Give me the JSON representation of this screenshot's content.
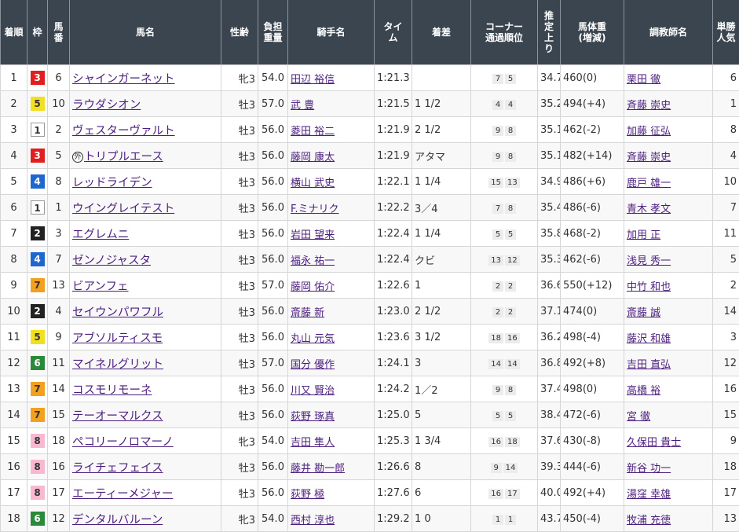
{
  "headers": [
    "着順",
    "枠",
    "馬番",
    "馬名",
    "性齢",
    "負担重量",
    "騎手名",
    "タイム",
    "着差",
    "コーナー通過順位",
    "推定上り",
    "馬体重(増減)",
    "調教師名",
    "単勝人気"
  ],
  "header_html": [
    "着順",
    "枠",
    "馬<br>番",
    "馬名",
    "性齢",
    "負担<br>重量",
    "騎手名",
    "タイ<br>ム",
    "着差",
    "コーナー<br>通過順位",
    "推<br>定<br>上<br>り",
    "馬体重<br>(増減)",
    "調教師名",
    "単勝<br>人気"
  ],
  "rows": [
    {
      "rank": "1",
      "waku": "3",
      "num": "6",
      "mark": "",
      "horse": "シャインガーネット",
      "sex_age": "牝3",
      "weight": "54.0",
      "jockey": "田辺 裕信",
      "time": "1:21.3",
      "margin": "",
      "corners": [
        "7",
        "5"
      ],
      "last3f": "34.7",
      "body_weight": "460(0)",
      "trainer": "栗田 徹",
      "pop": "6"
    },
    {
      "rank": "2",
      "waku": "5",
      "num": "10",
      "mark": "",
      "horse": "ラウダシオン",
      "sex_age": "牡3",
      "weight": "57.0",
      "jockey": "武 豊",
      "time": "1:21.5",
      "margin": "1 1/2",
      "corners": [
        "4",
        "4"
      ],
      "last3f": "35.2",
      "body_weight": "494(+4)",
      "trainer": "斉藤 崇史",
      "pop": "1"
    },
    {
      "rank": "3",
      "waku": "1",
      "num": "2",
      "mark": "",
      "horse": "ヴェスターヴァルト",
      "sex_age": "牡3",
      "weight": "56.0",
      "jockey": "菱田 裕二",
      "time": "1:21.9",
      "margin": "2 1/2",
      "corners": [
        "9",
        "8"
      ],
      "last3f": "35.1",
      "body_weight": "462(-2)",
      "trainer": "加藤 征弘",
      "pop": "8"
    },
    {
      "rank": "4",
      "waku": "3",
      "num": "5",
      "mark": "外",
      "horse": "トリプルエース",
      "sex_age": "牡3",
      "weight": "56.0",
      "jockey": "藤岡 康太",
      "time": "1:21.9",
      "margin": "アタマ",
      "corners": [
        "9",
        "8"
      ],
      "last3f": "35.1",
      "body_weight": "482(+14)",
      "trainer": "斉藤 崇史",
      "pop": "4"
    },
    {
      "rank": "5",
      "waku": "4",
      "num": "8",
      "mark": "",
      "horse": "レッドライデン",
      "sex_age": "牡3",
      "weight": "56.0",
      "jockey": "横山 武史",
      "time": "1:22.1",
      "margin": "1 1/4",
      "corners": [
        "15",
        "13"
      ],
      "last3f": "34.9",
      "body_weight": "486(+6)",
      "trainer": "鹿戸 雄一",
      "pop": "10"
    },
    {
      "rank": "6",
      "waku": "1",
      "num": "1",
      "mark": "",
      "horse": "ウイングレイテスト",
      "sex_age": "牡3",
      "weight": "56.0",
      "jockey": "F.ミナリク",
      "time": "1:22.2",
      "margin": "3／4",
      "corners": [
        "7",
        "8"
      ],
      "last3f": "35.4",
      "body_weight": "486(-6)",
      "trainer": "青木 孝文",
      "pop": "7"
    },
    {
      "rank": "7",
      "waku": "2",
      "num": "3",
      "mark": "",
      "horse": "エグレムニ",
      "sex_age": "牡3",
      "weight": "56.0",
      "jockey": "岩田 望来",
      "time": "1:22.4",
      "margin": "1 1/4",
      "corners": [
        "5",
        "5"
      ],
      "last3f": "35.8",
      "body_weight": "468(-2)",
      "trainer": "加用 正",
      "pop": "11"
    },
    {
      "rank": "8",
      "waku": "4",
      "num": "7",
      "mark": "",
      "horse": "ゼンノジャスタ",
      "sex_age": "牡3",
      "weight": "56.0",
      "jockey": "福永 祐一",
      "time": "1:22.4",
      "margin": "クビ",
      "corners": [
        "13",
        "12"
      ],
      "last3f": "35.3",
      "body_weight": "462(-6)",
      "trainer": "浅見 秀一",
      "pop": "5"
    },
    {
      "rank": "9",
      "waku": "7",
      "num": "13",
      "mark": "",
      "horse": "ビアンフェ",
      "sex_age": "牡3",
      "weight": "57.0",
      "jockey": "藤岡 佑介",
      "time": "1:22.6",
      "margin": "1",
      "corners": [
        "2",
        "2"
      ],
      "last3f": "36.6",
      "body_weight": "550(+12)",
      "trainer": "中竹 和也",
      "pop": "2"
    },
    {
      "rank": "10",
      "waku": "2",
      "num": "4",
      "mark": "",
      "horse": "セイウンパワフル",
      "sex_age": "牡3",
      "weight": "56.0",
      "jockey": "斎藤 新",
      "time": "1:23.0",
      "margin": "2 1/2",
      "corners": [
        "2",
        "2"
      ],
      "last3f": "37.1",
      "body_weight": "474(0)",
      "trainer": "斎藤 誠",
      "pop": "14"
    },
    {
      "rank": "11",
      "waku": "5",
      "num": "9",
      "mark": "",
      "horse": "アブソルティスモ",
      "sex_age": "牡3",
      "weight": "56.0",
      "jockey": "丸山 元気",
      "time": "1:23.6",
      "margin": "3 1/2",
      "corners": [
        "18",
        "16"
      ],
      "last3f": "36.2",
      "body_weight": "498(-4)",
      "trainer": "藤沢 和雄",
      "pop": "3"
    },
    {
      "rank": "12",
      "waku": "6",
      "num": "11",
      "mark": "",
      "horse": "マイネルグリット",
      "sex_age": "牡3",
      "weight": "57.0",
      "jockey": "国分 優作",
      "time": "1:24.1",
      "margin": "3",
      "corners": [
        "14",
        "14"
      ],
      "last3f": "36.8",
      "body_weight": "492(+8)",
      "trainer": "吉田 直弘",
      "pop": "12"
    },
    {
      "rank": "13",
      "waku": "7",
      "num": "14",
      "mark": "",
      "horse": "コスモリモーネ",
      "sex_age": "牡3",
      "weight": "56.0",
      "jockey": "川又 賢治",
      "time": "1:24.2",
      "margin": "1／2",
      "corners": [
        "9",
        "8"
      ],
      "last3f": "37.4",
      "body_weight": "498(0)",
      "trainer": "高橋 裕",
      "pop": "16"
    },
    {
      "rank": "14",
      "waku": "7",
      "num": "15",
      "mark": "",
      "horse": "テーオーマルクス",
      "sex_age": "牡3",
      "weight": "56.0",
      "jockey": "荻野 琢真",
      "time": "1:25.0",
      "margin": "5",
      "corners": [
        "5",
        "5"
      ],
      "last3f": "38.4",
      "body_weight": "472(-6)",
      "trainer": "宮 徹",
      "pop": "15"
    },
    {
      "rank": "15",
      "waku": "8",
      "num": "18",
      "mark": "",
      "horse": "ペコリーノロマーノ",
      "sex_age": "牝3",
      "weight": "54.0",
      "jockey": "吉田 隼人",
      "time": "1:25.3",
      "margin": "1 3/4",
      "corners": [
        "16",
        "18"
      ],
      "last3f": "37.6",
      "body_weight": "430(-8)",
      "trainer": "久保田 貴士",
      "pop": "9"
    },
    {
      "rank": "16",
      "waku": "8",
      "num": "16",
      "mark": "",
      "horse": "ライチェフェイス",
      "sex_age": "牡3",
      "weight": "56.0",
      "jockey": "藤井 勘一郎",
      "time": "1:26.6",
      "margin": "8",
      "corners": [
        "9",
        "14"
      ],
      "last3f": "39.3",
      "body_weight": "444(-6)",
      "trainer": "新谷 功一",
      "pop": "18"
    },
    {
      "rank": "17",
      "waku": "8",
      "num": "17",
      "mark": "",
      "horse": "エーティーメジャー",
      "sex_age": "牡3",
      "weight": "56.0",
      "jockey": "荻野 極",
      "time": "1:27.6",
      "margin": "6",
      "corners": [
        "16",
        "17"
      ],
      "last3f": "40.0",
      "body_weight": "492(+4)",
      "trainer": "湯窪 幸雄",
      "pop": "17"
    },
    {
      "rank": "18",
      "waku": "6",
      "num": "12",
      "mark": "",
      "horse": "デンタルバルーン",
      "sex_age": "牝3",
      "weight": "54.0",
      "jockey": "西村 淳也",
      "time": "1:29.2",
      "margin": "1 0",
      "corners": [
        "1",
        "1"
      ],
      "last3f": "43.7",
      "body_weight": "450(-4)",
      "trainer": "牧浦 充徳",
      "pop": "13"
    }
  ]
}
